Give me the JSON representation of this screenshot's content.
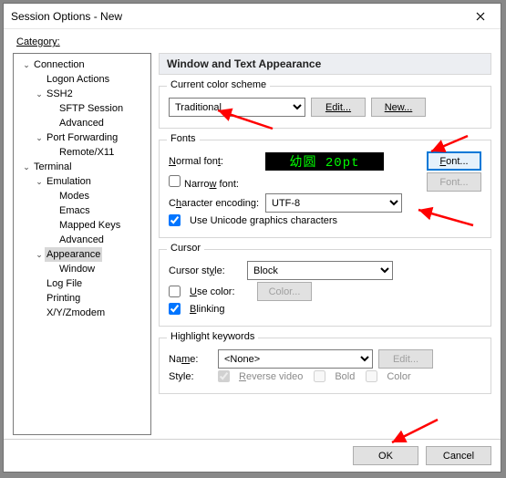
{
  "title": "Session Options - New",
  "category_label": "Category:",
  "tree": {
    "connection": "Connection",
    "logon_actions": "Logon Actions",
    "ssh2": "SSH2",
    "sftp_session": "SFTP Session",
    "advanced1": "Advanced",
    "port_forwarding": "Port Forwarding",
    "remote_x11": "Remote/X11",
    "terminal": "Terminal",
    "emulation": "Emulation",
    "modes": "Modes",
    "emacs": "Emacs",
    "mapped_keys": "Mapped Keys",
    "advanced2": "Advanced",
    "appearance": "Appearance",
    "window": "Window",
    "log_file": "Log File",
    "printing": "Printing",
    "xyzmodem": "X/Y/Zmodem"
  },
  "header": "Window and Text Appearance",
  "scheme": {
    "title": "Current color scheme",
    "value": "Traditional",
    "edit": "Edit...",
    "new": "New..."
  },
  "fonts": {
    "title": "Fonts",
    "normal_label": "Normal font:",
    "preview": "幼圆 20pt",
    "font_btn": "Font...",
    "narrow_label": "Narrow font:",
    "encoding_label": "Character encoding:",
    "encoding_value": "UTF-8",
    "unicode_label": "Use Unicode graphics characters"
  },
  "cursor": {
    "title": "Cursor",
    "style_label": "Cursor style:",
    "style_value": "Block",
    "use_color": "Use color:",
    "color_btn": "Color...",
    "blinking": "Blinking"
  },
  "highlight": {
    "title": "Highlight keywords",
    "name_label": "Name:",
    "name_value": "<None>",
    "edit": "Edit...",
    "style_label": "Style:",
    "reverse": "Reverse video",
    "bold": "Bold",
    "color": "Color"
  },
  "buttons": {
    "ok": "OK",
    "cancel": "Cancel"
  }
}
